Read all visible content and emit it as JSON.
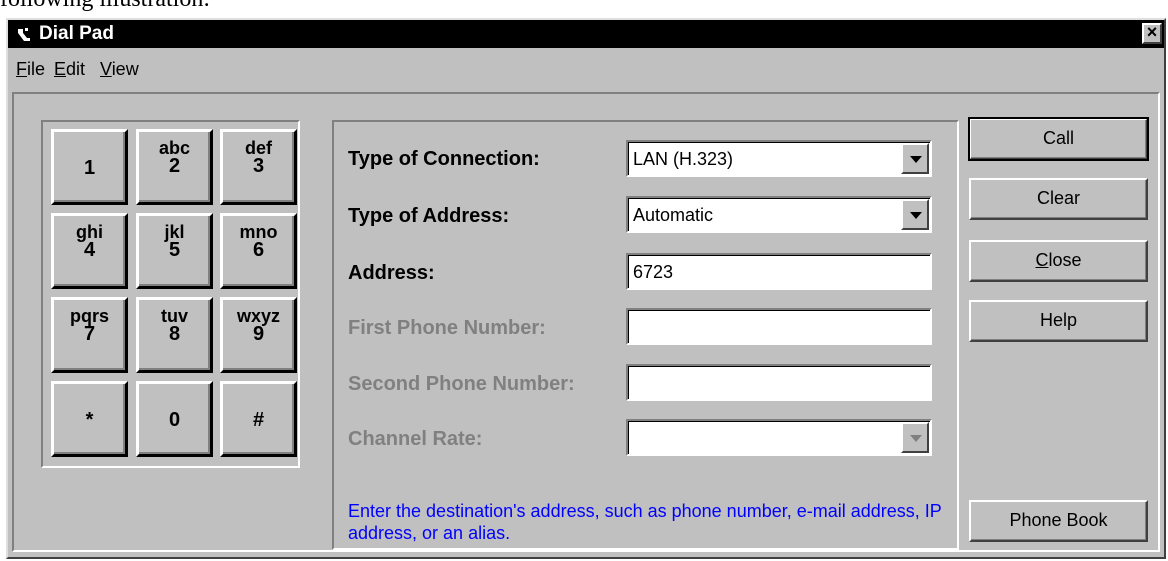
{
  "doc_text": "following illustration:",
  "window": {
    "title": "Dial Pad",
    "close_glyph": "×",
    "icon": "phone-icon"
  },
  "menu": {
    "items": [
      {
        "label": "File",
        "accel": "F",
        "rest": "ile"
      },
      {
        "label": "Edit",
        "accel": "E",
        "rest": "dit"
      },
      {
        "label": "View",
        "accel": "V",
        "rest": "iew"
      }
    ]
  },
  "keypad": {
    "keys": [
      {
        "digit": "1",
        "letters": ""
      },
      {
        "digit": "2",
        "letters": "abc"
      },
      {
        "digit": "3",
        "letters": "def"
      },
      {
        "digit": "4",
        "letters": "ghi"
      },
      {
        "digit": "5",
        "letters": "jkl"
      },
      {
        "digit": "6",
        "letters": "mno"
      },
      {
        "digit": "7",
        "letters": "pqrs"
      },
      {
        "digit": "8",
        "letters": "tuv"
      },
      {
        "digit": "9",
        "letters": "wxyz"
      },
      {
        "digit": "*",
        "letters": ""
      },
      {
        "digit": "0",
        "letters": ""
      },
      {
        "digit": "#",
        "letters": ""
      }
    ]
  },
  "form": {
    "connection_label": "Type of Connection:",
    "connection_value": "LAN (H.323)",
    "address_type_label": "Type of Address:",
    "address_type_value": "Automatic",
    "address_label": "Address:",
    "address_value": "6723",
    "first_phone_label": "First Phone Number:",
    "first_phone_value": "",
    "second_phone_label": "Second Phone Number:",
    "second_phone_value": "",
    "channel_rate_label": "Channel Rate:",
    "channel_rate_value": "",
    "hint": "Enter the destination's address, such as phone number, e-mail address, IP address, or an alias."
  },
  "buttons": {
    "call": "Call",
    "clear": "Clear",
    "close_accel": "C",
    "close_rest": "lose",
    "help": "Help",
    "phone_book": "Phone Book"
  }
}
